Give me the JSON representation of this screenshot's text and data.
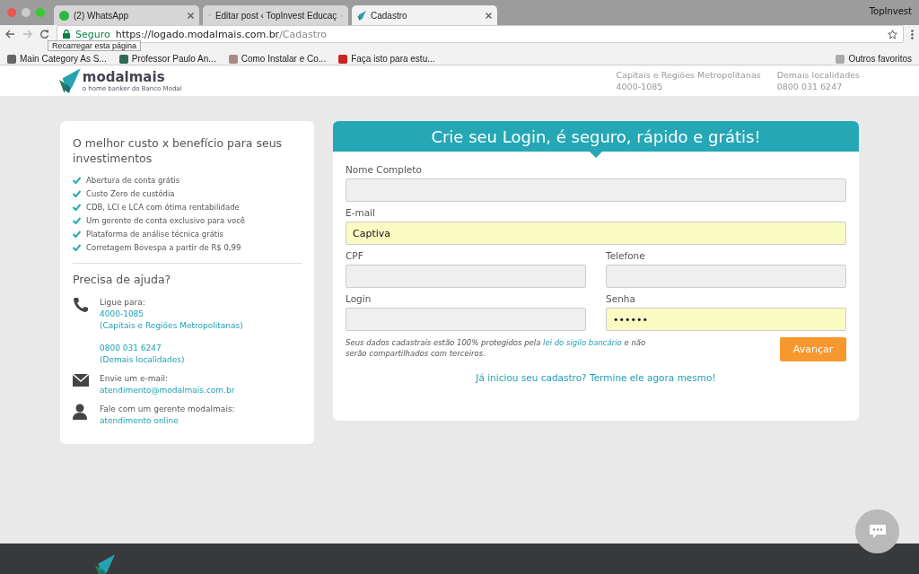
{
  "browser": {
    "tabs": [
      {
        "title": "(2) WhatsApp",
        "selected": false
      },
      {
        "title": "Editar post ‹ TopInvest Educaç",
        "selected": false
      },
      {
        "title": "Cadastro",
        "selected": true
      }
    ],
    "profile": "TopInvest",
    "address": {
      "secure_label": "Seguro",
      "host": "https://logado.modalmais.com.br",
      "path": "/Cadastro"
    },
    "tooltip": "Recarregar esta página",
    "bookmarks": [
      "Main Category As S...",
      "Professor Paulo An...",
      "Como Instalar e Co...",
      "Faça isto para estu..."
    ],
    "other_bookmarks": "Outros favoritos"
  },
  "site_header": {
    "logo": "modalmais",
    "tagline": "o home banker do Banco Modal",
    "contacts": [
      {
        "label": "Capitais e Regiões Metropolitanas",
        "phone": "4000-1085"
      },
      {
        "label": "Demais localidades",
        "phone": "0800 031 6247"
      }
    ]
  },
  "benefits": {
    "title": "O melhor custo x benefício para seus investimentos",
    "items": [
      "Abertura de conta grátis",
      "Custo Zero de custódia",
      "CDB, LCI e LCA com ótima rentabilidade",
      "Um gerente de conta exclusivo para você",
      "Plataforma de análise técnica grátis",
      "Corretagem Bovespa a partir de R$ 0,99"
    ],
    "help_title": "Precisa de ajuda?",
    "help": [
      {
        "kind": "phone",
        "label": "Ligue para:",
        "groups": [
          [
            "4000-1085",
            "(Capitais e Regiões Metropolitanas)"
          ],
          [
            "0800 031 6247",
            "(Demais localidades)"
          ]
        ]
      },
      {
        "kind": "email",
        "label": "Envie um e-mail:",
        "groups": [
          [
            "atendimento@modalmais.com.br"
          ]
        ]
      },
      {
        "kind": "person",
        "label": "Fale com um gerente modalmais:",
        "groups": [
          [
            "atendimento online"
          ]
        ]
      }
    ]
  },
  "form": {
    "title": "Crie seu Login, é seguro, rápido e grátis!",
    "fields": [
      {
        "label": "Nome Completo",
        "wide": true,
        "autofilled": false,
        "kind": "text"
      },
      {
        "label": "E-mail",
        "value": "Captiva",
        "wide": true,
        "autofilled": true,
        "kind": "text"
      },
      {
        "label": "CPF",
        "wide": false,
        "autofilled": false,
        "kind": "text"
      },
      {
        "label": "Telefone",
        "wide": false,
        "autofilled": false,
        "kind": "text"
      },
      {
        "label": "Login",
        "wide": false,
        "autofilled": false,
        "kind": "text"
      },
      {
        "label": "Senha",
        "value": "••••••",
        "wide": false,
        "autofilled": true,
        "kind": "password"
      }
    ],
    "note": {
      "before": "Seus dados cadastrais estão 100% protegidos pela ",
      "link": "lei do sigilo bancário",
      "after": " e não serão compartilhados com terceiros."
    },
    "submit": "Avançar",
    "resume_link": "Já iniciou seu cadastro? Termine ele agora mesmo!"
  }
}
